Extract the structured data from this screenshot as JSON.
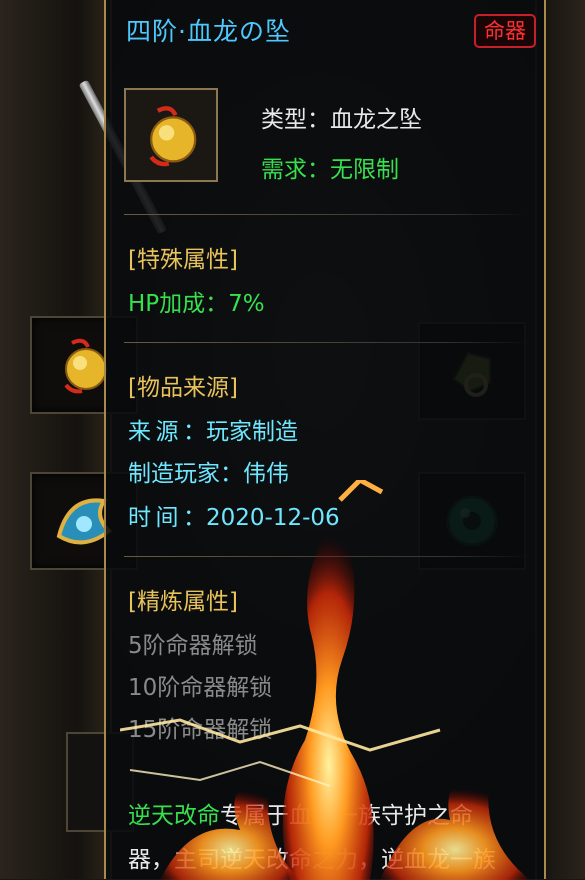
{
  "tooltip": {
    "title": "四阶·血龙の坠",
    "badge": "命器",
    "type_label": "类型：",
    "type_value": "血龙之坠",
    "req_label": "需求：",
    "req_value": "无限制",
    "special_header": "[特殊属性]",
    "hp_line": "HP加成：7%",
    "source_header": "[物品来源]",
    "source_label": "来源：",
    "source_value": "玩家制造",
    "maker_label": "制造玩家：",
    "maker_value": "伟伟",
    "time_label": "时间：",
    "time_value": "2020-12-06",
    "refine_header": "[精炼属性]",
    "refine_lines": [
      "5阶命器解锁",
      "10阶命器解锁",
      "15阶命器解锁"
    ],
    "desc_highlight": "逆天改命",
    "desc_rest1": "专属于血龙一族守护之命",
    "desc_line2": "器，主司逆天改命之力，逆血龙一族"
  },
  "icons": {
    "equipped_item": "gold-pendant-icon",
    "left_slot_1": "gold-pendant-icon",
    "left_slot_2": "blue-gold-ornament-icon",
    "right_slot_1": "green-gem-icon",
    "right_slot_2": "jade-disc-icon",
    "weapon": "sword-icon"
  },
  "colors": {
    "title": "#4ec8ff",
    "badge": "#ff3030",
    "requirement": "#37e04d",
    "section_header": "#e8c25a",
    "source_values": "#6ee7ff",
    "refine_locked": "#8a8a8a",
    "panel_border": "#a88a4a"
  }
}
